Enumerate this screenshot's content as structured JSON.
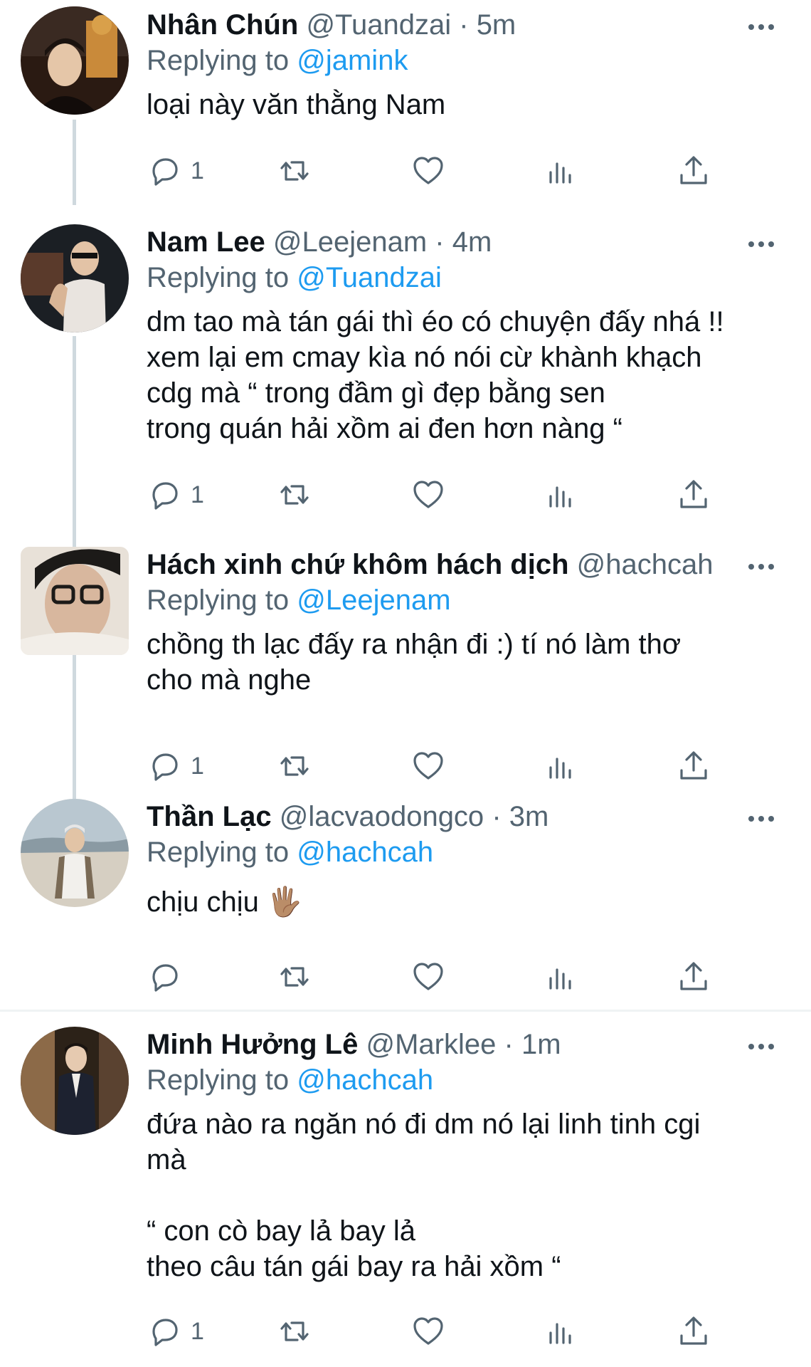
{
  "tweets": [
    {
      "display_name": "Nhân Chún",
      "handle": "@Tuandzai",
      "time": "5m",
      "replying_prefix": "Replying to",
      "replying_to": "@jamink",
      "text": "loại này văn thằng Nam",
      "reply_count": "1",
      "avatar_colors": [
        "#2a1a12",
        "#c98a3a",
        "#3d2a1d"
      ]
    },
    {
      "display_name": "Nam Lee",
      "handle": "@Leejenam",
      "time": "4m",
      "replying_prefix": "Replying to",
      "replying_to": "@Tuandzai",
      "text": "dm tao mà tán gái thì éo có chuyện đấy nhá !!\nxem lại em cmay kìa nó nói cừ khành khạch\ncdg mà “ trong đầm gì đẹp bằng sen\ntrong quán hải xồm ai đen hơn nàng “",
      "reply_count": "1",
      "avatar_colors": [
        "#1b1f24",
        "#e9e4df",
        "#5a3a2b"
      ]
    },
    {
      "display_name": "Hách xinh chứ khôm hách dịch",
      "handle": "@hachcah",
      "time": "",
      "replying_prefix": "Replying to",
      "replying_to": "@Leejenam",
      "text": "chồng th lạc đấy ra nhận đi :) tí nó làm thơ\ncho mà nghe",
      "reply_count": "1",
      "avatar_colors": [
        "#e8e1d8",
        "#c9a68c",
        "#1c1a18"
      ]
    },
    {
      "display_name": "Thần Lạc",
      "handle": "@lacvaodongco",
      "time": "3m",
      "replying_prefix": "Replying to",
      "replying_to": "@hachcah",
      "text": "chịu chịu 🖐🏽",
      "reply_count": "",
      "avatar_colors": [
        "#b9c7d0",
        "#8a9aa3",
        "#d6cfc2"
      ]
    },
    {
      "display_name": "Minh Hưởng Lê",
      "handle": "@Marklee",
      "time": "1m",
      "replying_prefix": "Replying to",
      "replying_to": "@hachcah",
      "text": "đứa nào ra ngăn nó đi dm nó lại linh tinh cgi\nmà\n\n“ con cò bay lả bay lả\ntheo câu tán gái bay ra hải xồm “",
      "reply_count": "1",
      "avatar_colors": [
        "#2c2218",
        "#8c6a48",
        "#1d2230"
      ]
    }
  ],
  "colors": {
    "text": "#0f1419",
    "secondary": "#536471",
    "link": "#1d9bf0",
    "thread_line": "#cfd9de"
  },
  "icons": [
    "reply-icon",
    "retweet-icon",
    "like-icon",
    "views-icon",
    "share-icon",
    "more-icon"
  ]
}
